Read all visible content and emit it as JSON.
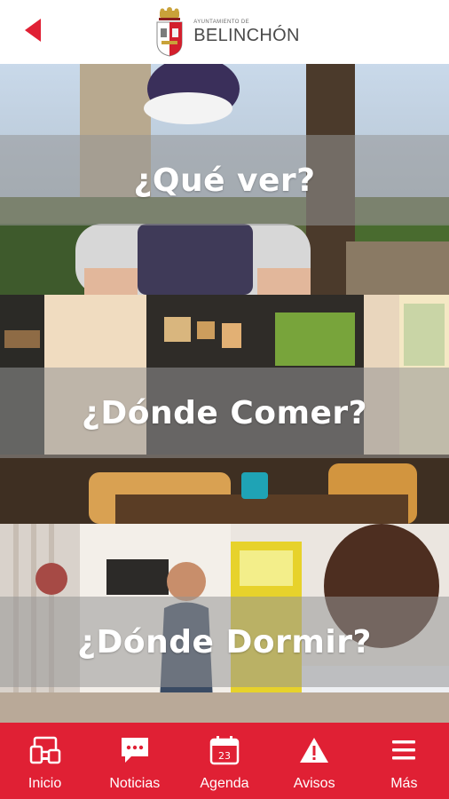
{
  "header": {
    "logo_subtitle": "Ayuntamiento de",
    "logo_name": "BELINCHÓN"
  },
  "sections": [
    {
      "title": "¿Qué ver?"
    },
    {
      "title": "¿Dónde Comer?"
    },
    {
      "title": "¿Dónde Dormir?"
    }
  ],
  "tabbar": {
    "tabs": [
      {
        "label": "Inicio",
        "icon": "devices-icon"
      },
      {
        "label": "Noticias",
        "icon": "chat-icon"
      },
      {
        "label": "Agenda",
        "icon": "calendar-icon",
        "day": "23"
      },
      {
        "label": "Avisos",
        "icon": "warning-icon"
      },
      {
        "label": "Más",
        "icon": "menu-icon"
      }
    ]
  },
  "colors": {
    "accent": "#e02034",
    "band": "#969696"
  }
}
